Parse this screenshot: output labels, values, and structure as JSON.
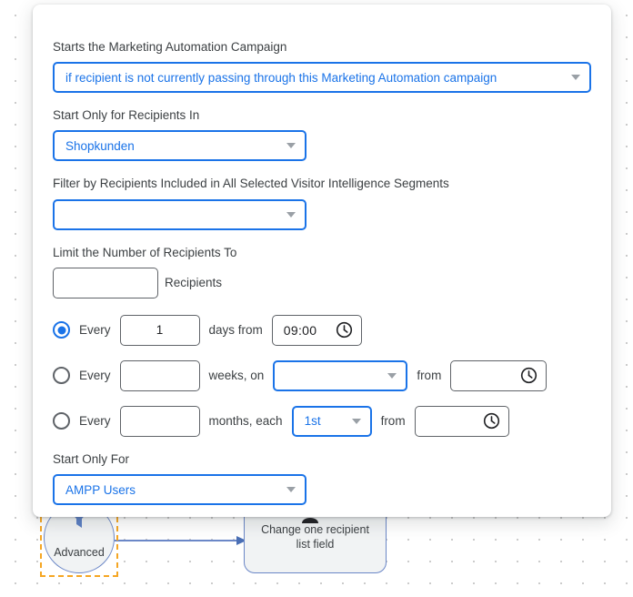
{
  "dialog": {
    "fields": {
      "campaign_start_label": "Starts the Marketing Automation Campaign",
      "campaign_start_value": "if recipient is not currently passing through this Marketing Automation campaign",
      "recipients_in_label": "Start Only for Recipients In",
      "recipients_in_value": "Shopkunden",
      "segments_label": "Filter by Recipients Included in All Selected Visitor Intelligence Segments",
      "segments_value": "",
      "limit_label": "Limit the Number of Recipients To",
      "limit_value": "",
      "limit_suffix": "Recipients",
      "start_only_for_label": "Start Only For",
      "start_only_for_value": "AMPP Users"
    },
    "schedule": {
      "days": {
        "selected": true,
        "every_label": "Every",
        "interval_value": "1",
        "unit_label": "days from",
        "time_value": "09:00"
      },
      "weeks": {
        "selected": false,
        "every_label": "Every",
        "interval_value": "",
        "unit_label": "weeks, on",
        "day_value": "",
        "from_label": "from",
        "time_value": ""
      },
      "months": {
        "selected": false,
        "every_label": "Every",
        "interval_value": "",
        "unit_label": "months, each",
        "day_value": "1st",
        "from_label": "from",
        "time_value": ""
      }
    }
  },
  "canvas": {
    "nodes": [
      {
        "id": "advanced",
        "label": "Advanced",
        "icon": "funnel-icon",
        "selected": true
      },
      {
        "id": "change-recipient-field",
        "label": "Change one recipient list field",
        "icon": "person-gear-icon",
        "selected": false
      }
    ]
  },
  "colors": {
    "accent": "#1a73e8",
    "selection": "#f5a623",
    "node_border": "#6b87c7",
    "node_fill": "#f1f3f4",
    "text": "#3c4043"
  }
}
